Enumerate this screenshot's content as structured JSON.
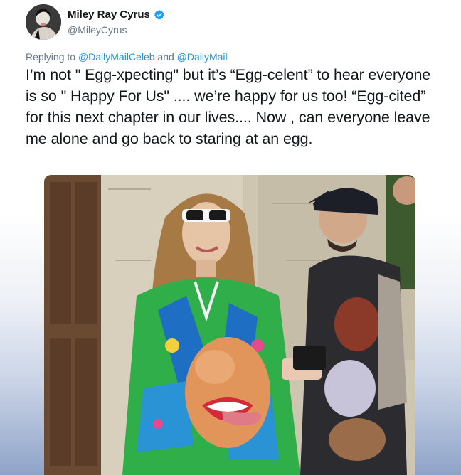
{
  "tweet": {
    "display_name": "Miley Ray Cyrus",
    "handle": "@MileyCyrus",
    "reply_prefix": "Replying to ",
    "reply_mention_1": "@DailyMailCeleb",
    "reply_conjunction": " and ",
    "reply_mention_2": "@DailyMail",
    "text": "I’m not \" Egg-xpecting\" but it’s “Egg-celent” to hear everyone is so \" Happy For Us\" .... we’re happy for us too! “Egg-cited” for this next chapter in our lives.... Now , can everyone leave me alone and go back to staring at an egg.",
    "verified_icon": "verified-badge-icon"
  },
  "colors": {
    "link": "#1b95e0",
    "secondary_text": "#657786",
    "primary_text": "#14171a",
    "verified": "#1da1f2"
  },
  "media": {
    "icon": "photo-icon"
  }
}
